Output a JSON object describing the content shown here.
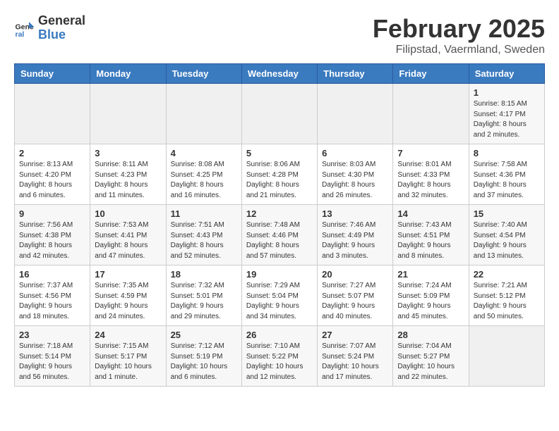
{
  "header": {
    "logo_line1": "General",
    "logo_line2": "Blue",
    "month": "February 2025",
    "location": "Filipstad, Vaermland, Sweden"
  },
  "weekdays": [
    "Sunday",
    "Monday",
    "Tuesday",
    "Wednesday",
    "Thursday",
    "Friday",
    "Saturday"
  ],
  "weeks": [
    [
      {
        "day": "",
        "info": ""
      },
      {
        "day": "",
        "info": ""
      },
      {
        "day": "",
        "info": ""
      },
      {
        "day": "",
        "info": ""
      },
      {
        "day": "",
        "info": ""
      },
      {
        "day": "",
        "info": ""
      },
      {
        "day": "1",
        "info": "Sunrise: 8:15 AM\nSunset: 4:17 PM\nDaylight: 8 hours and 2 minutes."
      }
    ],
    [
      {
        "day": "2",
        "info": "Sunrise: 8:13 AM\nSunset: 4:20 PM\nDaylight: 8 hours and 6 minutes."
      },
      {
        "day": "3",
        "info": "Sunrise: 8:11 AM\nSunset: 4:23 PM\nDaylight: 8 hours and 11 minutes."
      },
      {
        "day": "4",
        "info": "Sunrise: 8:08 AM\nSunset: 4:25 PM\nDaylight: 8 hours and 16 minutes."
      },
      {
        "day": "5",
        "info": "Sunrise: 8:06 AM\nSunset: 4:28 PM\nDaylight: 8 hours and 21 minutes."
      },
      {
        "day": "6",
        "info": "Sunrise: 8:03 AM\nSunset: 4:30 PM\nDaylight: 8 hours and 26 minutes."
      },
      {
        "day": "7",
        "info": "Sunrise: 8:01 AM\nSunset: 4:33 PM\nDaylight: 8 hours and 32 minutes."
      },
      {
        "day": "8",
        "info": "Sunrise: 7:58 AM\nSunset: 4:36 PM\nDaylight: 8 hours and 37 minutes."
      }
    ],
    [
      {
        "day": "9",
        "info": "Sunrise: 7:56 AM\nSunset: 4:38 PM\nDaylight: 8 hours and 42 minutes."
      },
      {
        "day": "10",
        "info": "Sunrise: 7:53 AM\nSunset: 4:41 PM\nDaylight: 8 hours and 47 minutes."
      },
      {
        "day": "11",
        "info": "Sunrise: 7:51 AM\nSunset: 4:43 PM\nDaylight: 8 hours and 52 minutes."
      },
      {
        "day": "12",
        "info": "Sunrise: 7:48 AM\nSunset: 4:46 PM\nDaylight: 8 hours and 57 minutes."
      },
      {
        "day": "13",
        "info": "Sunrise: 7:46 AM\nSunset: 4:49 PM\nDaylight: 9 hours and 3 minutes."
      },
      {
        "day": "14",
        "info": "Sunrise: 7:43 AM\nSunset: 4:51 PM\nDaylight: 9 hours and 8 minutes."
      },
      {
        "day": "15",
        "info": "Sunrise: 7:40 AM\nSunset: 4:54 PM\nDaylight: 9 hours and 13 minutes."
      }
    ],
    [
      {
        "day": "16",
        "info": "Sunrise: 7:37 AM\nSunset: 4:56 PM\nDaylight: 9 hours and 18 minutes."
      },
      {
        "day": "17",
        "info": "Sunrise: 7:35 AM\nSunset: 4:59 PM\nDaylight: 9 hours and 24 minutes."
      },
      {
        "day": "18",
        "info": "Sunrise: 7:32 AM\nSunset: 5:01 PM\nDaylight: 9 hours and 29 minutes."
      },
      {
        "day": "19",
        "info": "Sunrise: 7:29 AM\nSunset: 5:04 PM\nDaylight: 9 hours and 34 minutes."
      },
      {
        "day": "20",
        "info": "Sunrise: 7:27 AM\nSunset: 5:07 PM\nDaylight: 9 hours and 40 minutes."
      },
      {
        "day": "21",
        "info": "Sunrise: 7:24 AM\nSunset: 5:09 PM\nDaylight: 9 hours and 45 minutes."
      },
      {
        "day": "22",
        "info": "Sunrise: 7:21 AM\nSunset: 5:12 PM\nDaylight: 9 hours and 50 minutes."
      }
    ],
    [
      {
        "day": "23",
        "info": "Sunrise: 7:18 AM\nSunset: 5:14 PM\nDaylight: 9 hours and 56 minutes."
      },
      {
        "day": "24",
        "info": "Sunrise: 7:15 AM\nSunset: 5:17 PM\nDaylight: 10 hours and 1 minute."
      },
      {
        "day": "25",
        "info": "Sunrise: 7:12 AM\nSunset: 5:19 PM\nDaylight: 10 hours and 6 minutes."
      },
      {
        "day": "26",
        "info": "Sunrise: 7:10 AM\nSunset: 5:22 PM\nDaylight: 10 hours and 12 minutes."
      },
      {
        "day": "27",
        "info": "Sunrise: 7:07 AM\nSunset: 5:24 PM\nDaylight: 10 hours and 17 minutes."
      },
      {
        "day": "28",
        "info": "Sunrise: 7:04 AM\nSunset: 5:27 PM\nDaylight: 10 hours and 22 minutes."
      },
      {
        "day": "",
        "info": ""
      }
    ]
  ]
}
